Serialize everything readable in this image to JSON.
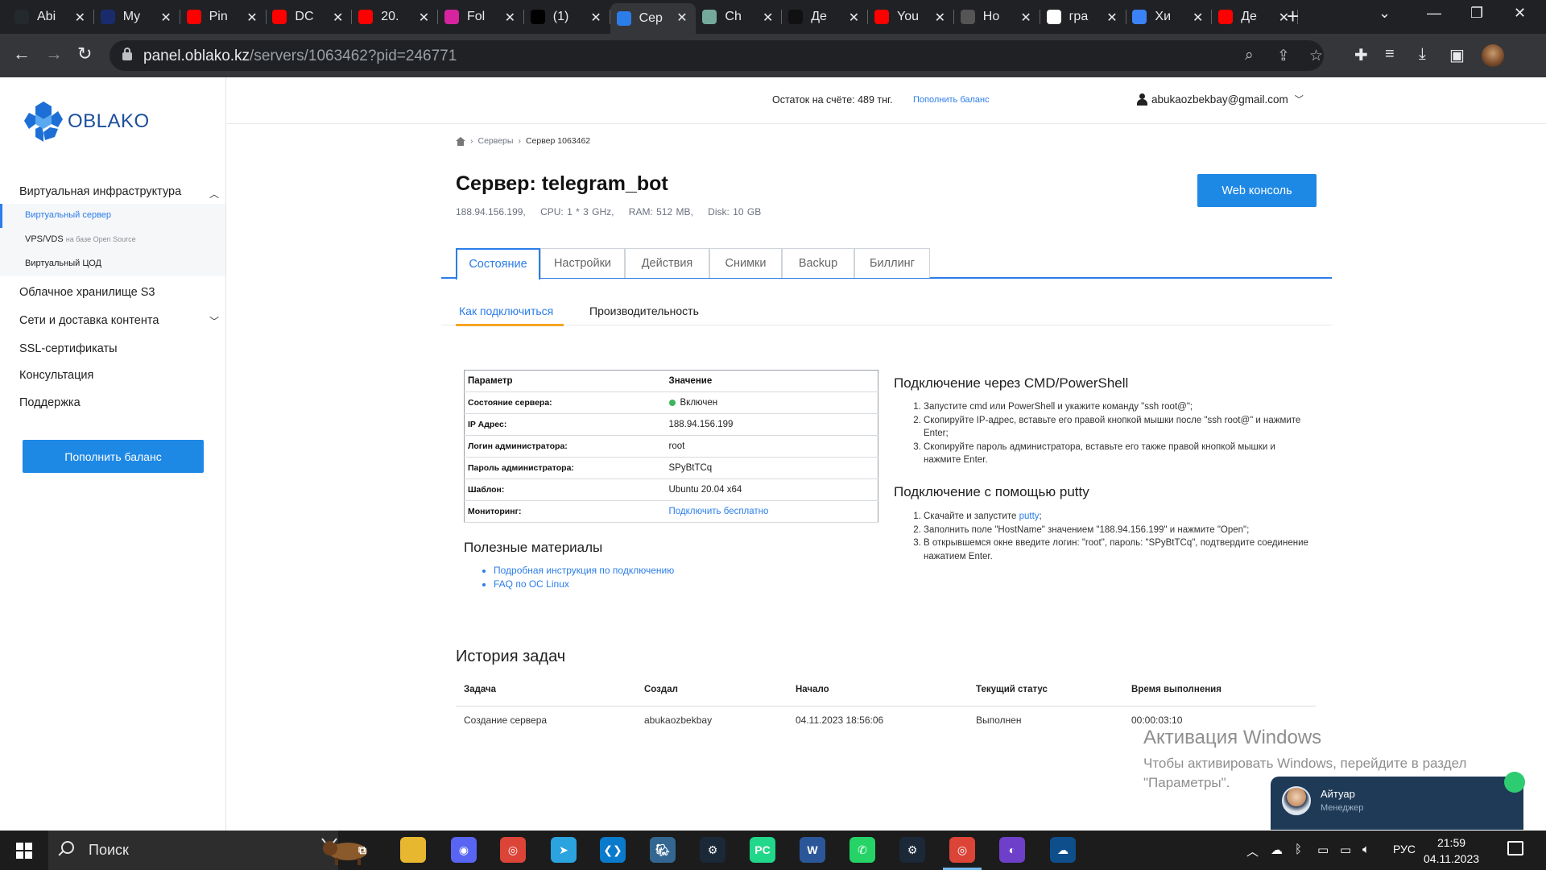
{
  "browser": {
    "tabs": [
      {
        "title": "Abi",
        "icon": "github-icon",
        "color": "#24292e"
      },
      {
        "title": "My",
        "icon": "stripe-icon",
        "color": "#1a2b6d"
      },
      {
        "title": "Pin",
        "icon": "youtube-icon",
        "color": "#ff0000"
      },
      {
        "title": "DC",
        "icon": "youtube-icon",
        "color": "#ff0000"
      },
      {
        "title": "20.",
        "icon": "youtube-icon",
        "color": "#ff0000"
      },
      {
        "title": "Fol",
        "icon": "instagram-icon",
        "color": "#d6249f"
      },
      {
        "title": "(1)",
        "icon": "tiktok-icon",
        "color": "#010101"
      },
      {
        "title": "Сер",
        "icon": "oblako-icon",
        "color": "#2b7de9",
        "active": true
      },
      {
        "title": "Ch",
        "icon": "chatgpt-icon",
        "color": "#74aa9c"
      },
      {
        "title": "Де",
        "icon": "sparkle-icon",
        "color": "#111111"
      },
      {
        "title": "You",
        "icon": "youtube-icon",
        "color": "#ff0000"
      },
      {
        "title": "Но",
        "icon": "chrome-icon",
        "color": "#555555"
      },
      {
        "title": "гра",
        "icon": "google-icon",
        "color": "#ffffff"
      },
      {
        "title": "Хи",
        "icon": "people-icon",
        "color": "#3b82f6"
      },
      {
        "title": "Де",
        "icon": "youtube-icon",
        "color": "#ff0000"
      }
    ],
    "url_host": "panel.oblako.kz",
    "url_path": "/servers/1063462?pid=246771"
  },
  "sidebar": {
    "logo_text": "OBLAKO",
    "sections": [
      {
        "label": "Виртуальная инфраструктура",
        "expanded": true
      },
      {
        "label": "Облачное хранилище S3"
      },
      {
        "label": "Сети и доставка контента",
        "expandable": true
      },
      {
        "label": "SSL-сертификаты"
      },
      {
        "label": "Консультация"
      },
      {
        "label": "Поддержка"
      }
    ],
    "subitems": [
      {
        "label": "Виртуальный сервер",
        "active": true
      },
      {
        "label": "VPS/VDS",
        "note": "на базе Open Source"
      },
      {
        "label": "Виртуальный ЦОД"
      }
    ],
    "topup_button": "Пополнить баланс"
  },
  "header": {
    "balance_text": "Остаток на счёте: 489 тнг.",
    "topup_link": "Пополнить баланс",
    "user_email": "abukaozbekbay@gmail.com"
  },
  "breadcrumbs": [
    "Серверы",
    "Сервер 1063462"
  ],
  "server": {
    "title": "Сервер: telegram_bot",
    "ip": "188.94.156.199,",
    "cpu": "CPU: 1 * 3 GHz,",
    "ram": "RAM: 512 MB,",
    "disk": "Disk: 10 GB",
    "console_button": "Web консоль"
  },
  "tabs": [
    "Состояние",
    "Настройки",
    "Действия",
    "Снимки",
    "Backup",
    "Биллинг"
  ],
  "subtabs": [
    "Как подключиться",
    "Производительность"
  ],
  "info_table": {
    "headers": [
      "Параметр",
      "Значение"
    ],
    "rows": [
      {
        "k": "Состояние сервера:",
        "v": "Включен"
      },
      {
        "k": "IP Адрес:",
        "v": "188.94.156.199"
      },
      {
        "k": "Логин администратора:",
        "v": "root"
      },
      {
        "k": "Пароль администратора:",
        "v": "SPyBtTCq"
      },
      {
        "k": "Шаблон:",
        "v": "Ubuntu 20.04 x64"
      },
      {
        "k": "Мониторинг:",
        "v": "Подключить бесплатно"
      }
    ]
  },
  "materials": {
    "title": "Полезные материалы",
    "links": [
      "Подробная инструкция по подключению",
      "FAQ по ОС Linux"
    ]
  },
  "cmd": {
    "title": "Подключение через CMD/PowerShell",
    "steps": [
      "Запустите cmd или PowerShell и укажите команду \"ssh root@\";",
      "Скопируйте IP-адрес, вставьте его правой кнопкой мышки после \"ssh root@\" и нажмите Enter;",
      "Скопируйте пароль администратора, вставьте его также правой кнопкой мышки и нажмите Enter."
    ]
  },
  "putty": {
    "title": "Подключение с помощью putty",
    "step1_prefix": "Скачайте и запустите ",
    "step1_link": "putty",
    "step1_suffix": ";",
    "step2": "Заполнить поле \"HostName\" значением \"188.94.156.199\" и нажмите \"Open\";",
    "step3": "В открывшемся окне введите логин: \"root\", пароль: \"SPyBtTCq\", подтвердите соединение нажатием Enter."
  },
  "history": {
    "title": "История задач",
    "headers": [
      "Задача",
      "Создал",
      "Начало",
      "Текущий статус",
      "Время выполнения"
    ],
    "row": [
      "Создание сервера",
      "abukaozbekbay",
      "04.11.2023 18:56:06",
      "Выполнен",
      "00:00:03:10"
    ]
  },
  "activation": {
    "line1": "Активация Windows",
    "line2": "Чтобы активировать Windows, перейдите в раздел",
    "line3": "\"Параметры\"."
  },
  "chat": {
    "name": "Айтуар",
    "role": "Менеджер"
  },
  "taskbar": {
    "search_placeholder": "Поиск",
    "lang": "РУС",
    "time": "21:59",
    "date": "04.11.2023"
  }
}
